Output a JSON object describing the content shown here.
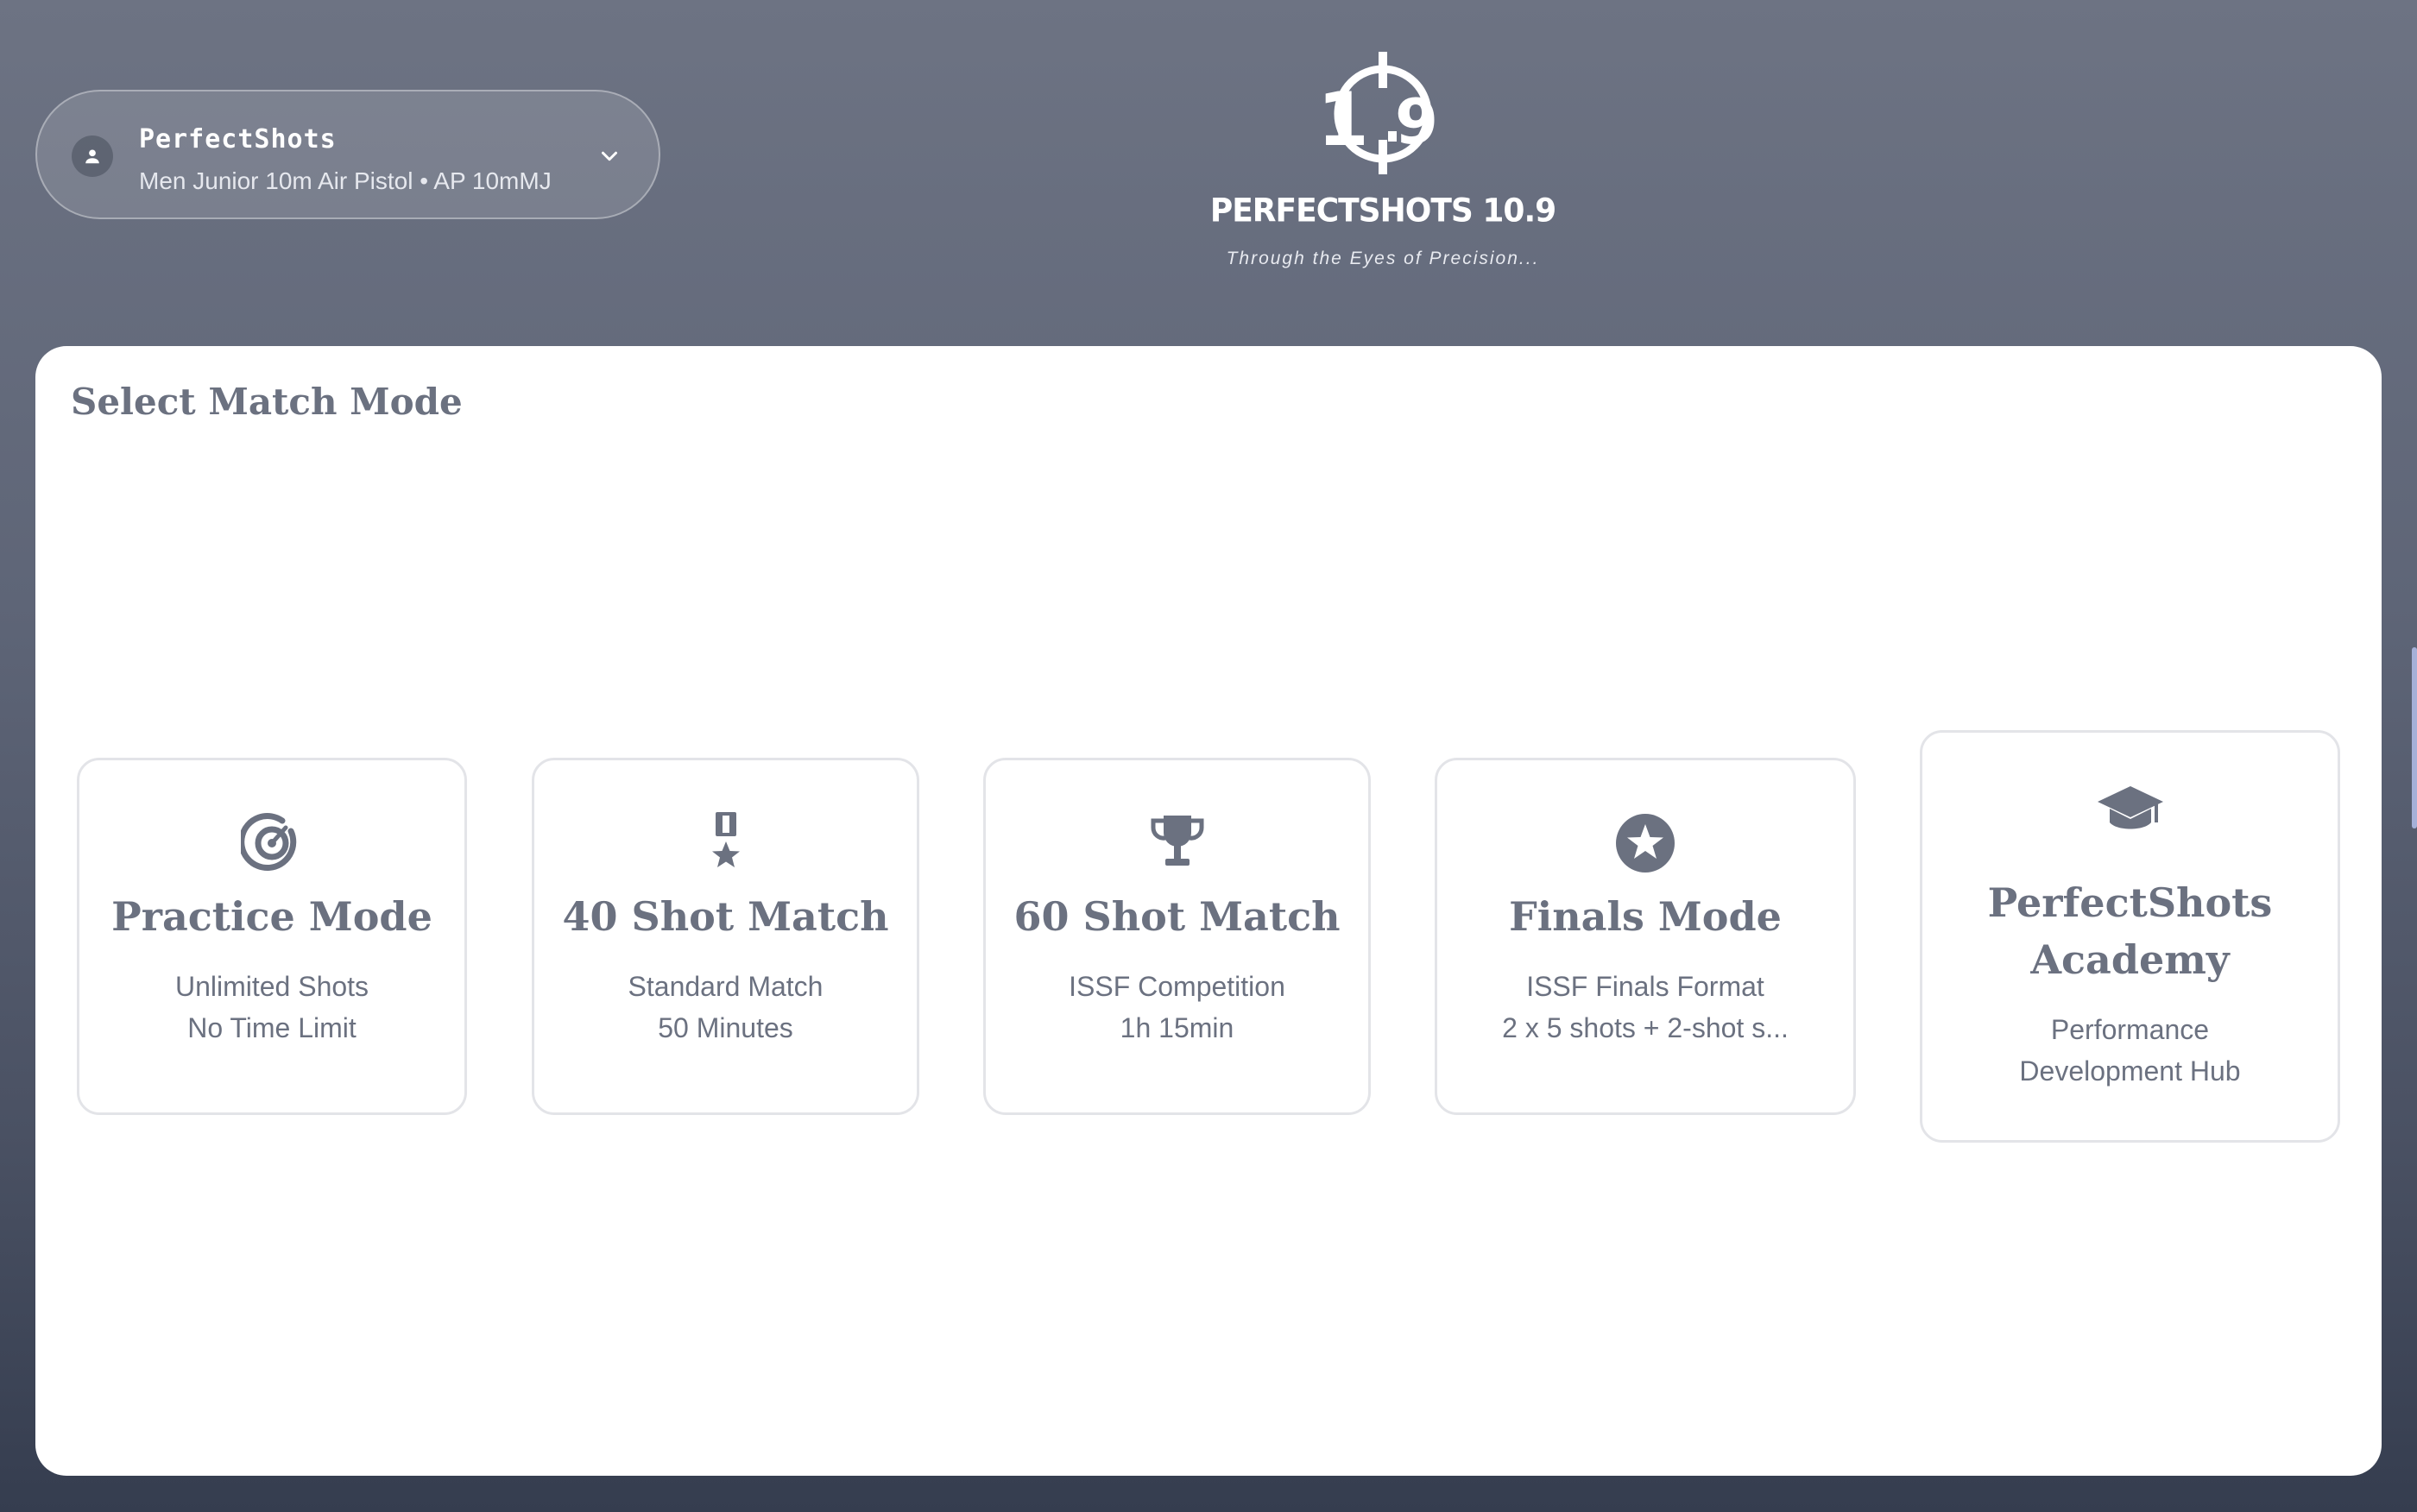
{
  "profile": {
    "name": "PerfectShots",
    "subtitle": "Men Junior 10m Air Pistol • AP 10mMJ",
    "avatar_icon": "person-icon",
    "expand_icon": "chevron-down-icon"
  },
  "brand": {
    "logo_text": "10.9",
    "name": "PERFECTSHOTS 10.9",
    "tagline": "Through the Eyes of Precision..."
  },
  "main": {
    "title": "Select Match Mode",
    "modes": [
      {
        "icon": "target-icon",
        "title": "Practice Mode",
        "desc": [
          "Unlimited Shots",
          "No Time Limit"
        ]
      },
      {
        "icon": "medal-icon",
        "title": "40 Shot Match",
        "desc": [
          "Standard Match",
          "50 Minutes"
        ]
      },
      {
        "icon": "trophy-icon",
        "title": "60 Shot Match",
        "desc": [
          "ISSF Competition",
          "1h 15min"
        ]
      },
      {
        "icon": "star-icon",
        "title": "Finals Mode",
        "desc": [
          "ISSF Finals Format",
          "2 x 5 shots + 2-shot s..."
        ]
      },
      {
        "icon": "graduation-cap-icon",
        "title": [
          "PerfectShots",
          "Academy"
        ],
        "desc": [
          "Performance",
          "Development Hub"
        ]
      }
    ]
  },
  "colors": {
    "text_muted": "#6b7180",
    "card_border": "#e3e4e8",
    "background_top": "#6d7383",
    "background_bottom": "#353d4f"
  }
}
